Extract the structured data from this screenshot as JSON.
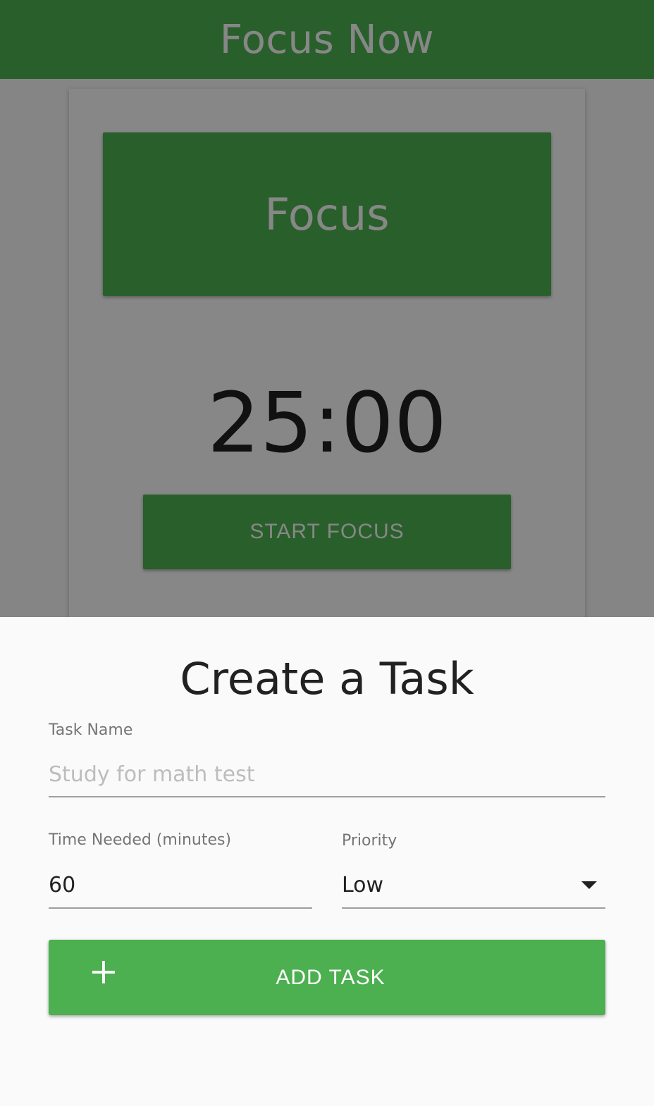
{
  "app_bar": {
    "title": "Focus Now"
  },
  "focus_card": {
    "mode_label": "Focus",
    "timer": "25:00",
    "start_button": "START FOCUS"
  },
  "sheet": {
    "title": "Create a Task",
    "task_name": {
      "label": "Task Name",
      "placeholder": "Study for math test",
      "value": ""
    },
    "time_needed": {
      "label": "Time Needed (minutes)",
      "value": "60"
    },
    "priority": {
      "label": "Priority",
      "selected": "Low"
    },
    "add_button": {
      "label": "ADD TASK",
      "icon": "plus-icon"
    }
  },
  "colors": {
    "primary": "#4caf50",
    "scrim": "rgba(0,0,0,0.46)",
    "sheet_bg": "#fafafa"
  }
}
